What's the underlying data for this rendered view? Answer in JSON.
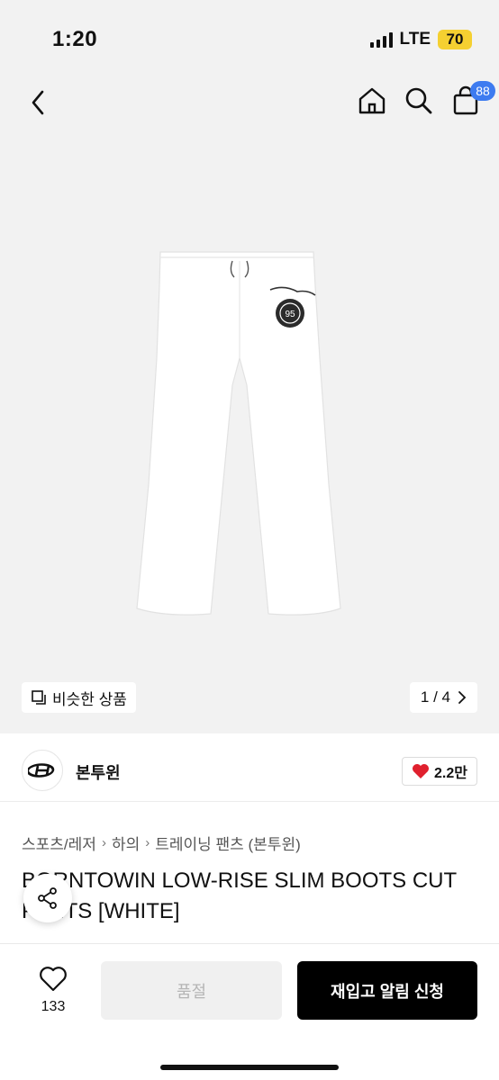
{
  "status": {
    "time": "1:20",
    "network": "LTE",
    "battery": "70"
  },
  "nav": {
    "cart_count": "88"
  },
  "gallery": {
    "similar_label": "비슷한 상품",
    "pager": "1 / 4",
    "patch_text": "95"
  },
  "brand": {
    "name": "본투윈",
    "likes": "2.2만"
  },
  "breadcrumb": [
    "스포츠/레저",
    "하의",
    "트레이닝 팬츠 (본투윈)"
  ],
  "product": {
    "title": "BORNTOWIN LOW-RISE SLIM BOOTS CUT PANTS [WHITE]"
  },
  "actions": {
    "wish_count": "133",
    "soldout_label": "품절",
    "restock_label": "재입고 알림 신청"
  },
  "colors": {
    "accent_badge": "#3d7bf0",
    "battery": "#f5d031",
    "like_heart": "#e0202e",
    "primary_button": "#000000"
  }
}
